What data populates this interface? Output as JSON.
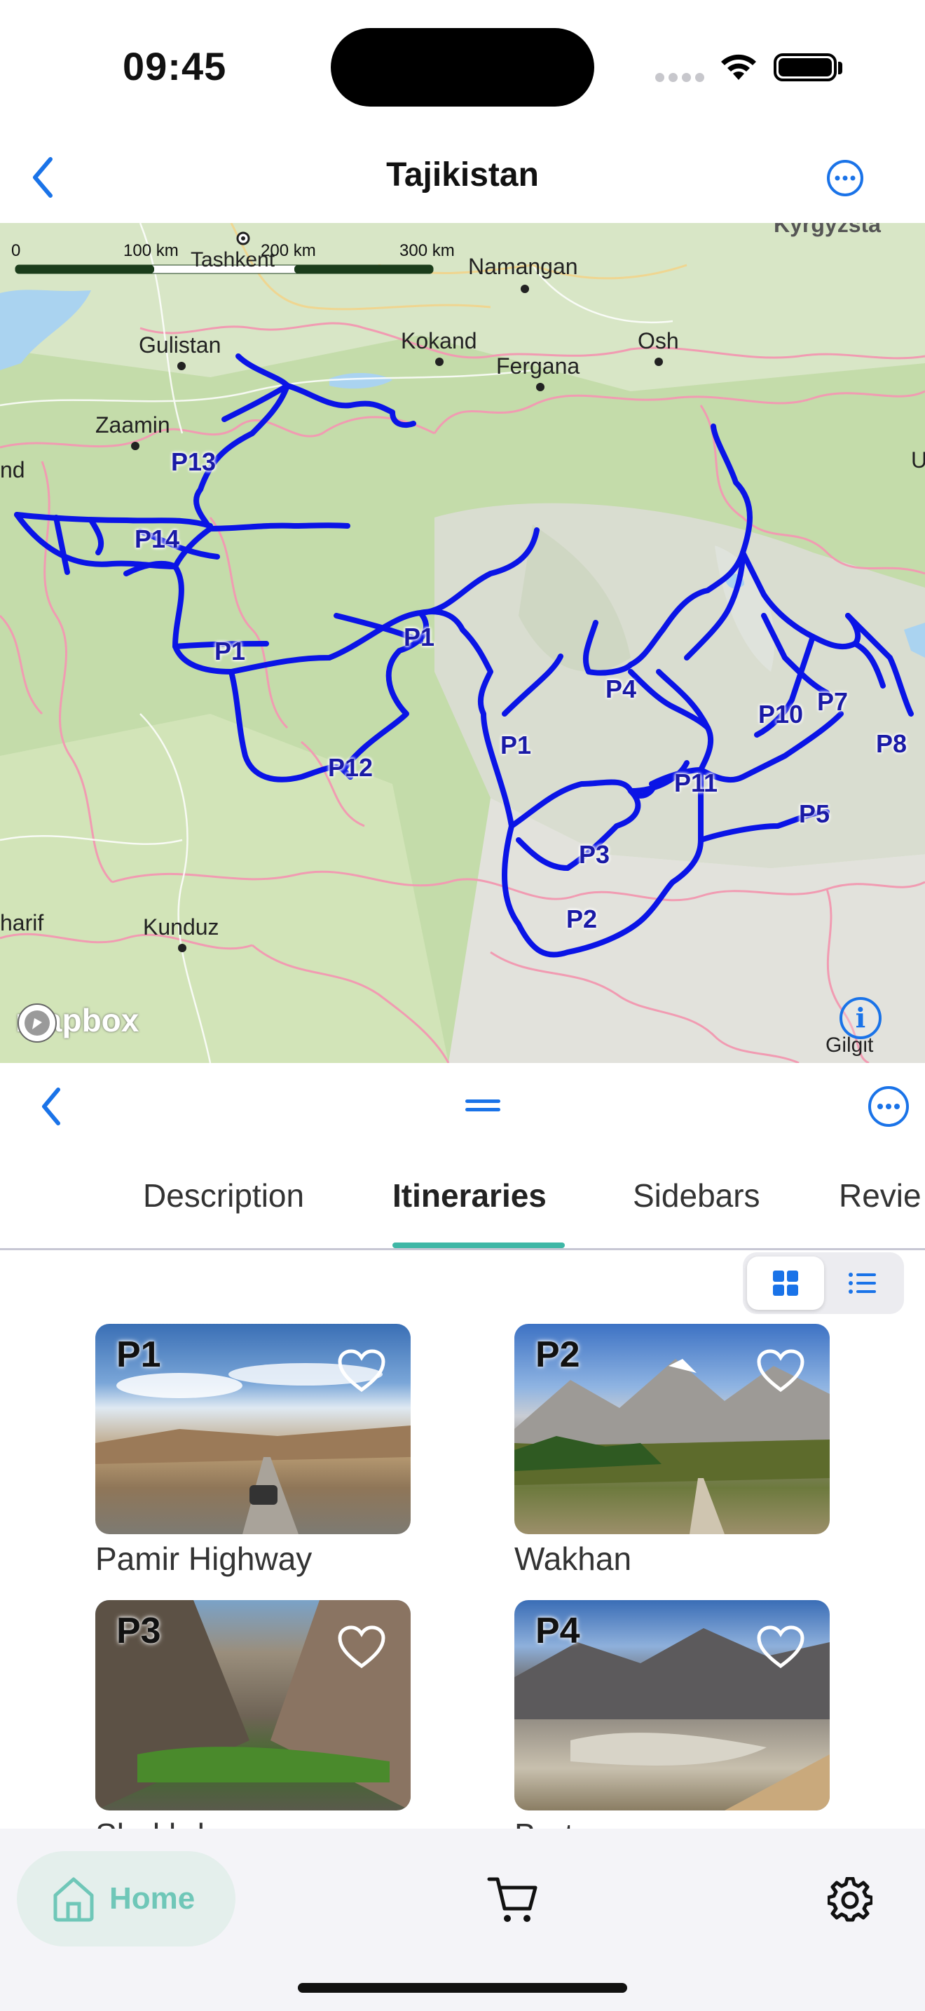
{
  "status": {
    "time": "09:45"
  },
  "nav": {
    "title": "Tajikistan",
    "back_icon": "chevron-left-icon",
    "more_icon": "ellipsis-circle-icon"
  },
  "map": {
    "scale": {
      "label_0": "0",
      "label_100": "100 km",
      "label_200": "200 km",
      "label_300": "300 km"
    },
    "cities": {
      "tashkent": "Tashkent",
      "namangan": "Namangan",
      "gulistan": "Gulistan",
      "kokand": "Kokand",
      "fergana": "Fergana",
      "osh": "Osh",
      "zaamin": "Zaamin",
      "samarkand_partial": "nd",
      "kyrgyzstan_partial": "Kyrgyzsta",
      "u_partial": "U",
      "sharif_partial": "harif",
      "kunduz": "Kunduz",
      "gilgit": "Gilgit"
    },
    "routes": {
      "p13": "P13",
      "p14": "P14",
      "p1a": "P1",
      "p1b": "P1",
      "p1c": "P1",
      "p12": "P12",
      "p4": "P4",
      "p10": "P10",
      "p7": "P7",
      "p8": "P8",
      "p11": "P11",
      "p5": "P5",
      "p3": "P3",
      "p2": "P2"
    },
    "attribution": "mapbox",
    "route_color": "#0a14e6"
  },
  "sheet": {
    "back_icon": "chevron-left-icon",
    "handle_icon": "drag-handle-icon",
    "more_icon": "ellipsis-circle-icon"
  },
  "tabs": [
    {
      "label": "Description",
      "active": false
    },
    {
      "label": "Itineraries",
      "active": true
    },
    {
      "label": "Sidebars",
      "active": false
    },
    {
      "label": "Revie",
      "active": false
    }
  ],
  "view_toggle": {
    "selected": "grid",
    "options": [
      "grid-icon",
      "list-icon"
    ]
  },
  "itineraries": [
    {
      "code": "P1",
      "title": "Pamir Highway"
    },
    {
      "code": "P2",
      "title": "Wakhan"
    },
    {
      "code": "P3",
      "title": "Shokhdara"
    },
    {
      "code": "P4",
      "title": "Bartang"
    }
  ],
  "bottom_bar": {
    "home_label": "Home",
    "cart_icon": "cart-icon",
    "settings_icon": "gear-icon"
  },
  "colors": {
    "accent_blue": "#1a73e8",
    "teal": "#3fb7a6",
    "route": "#0a14e6"
  }
}
